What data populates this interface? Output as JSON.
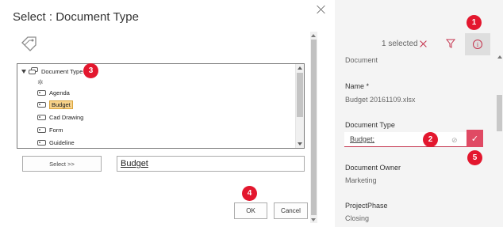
{
  "dialog": {
    "title": "Select : Document Type",
    "tree": {
      "root_label": "Document Type",
      "items": [
        {
          "label": "Agenda"
        },
        {
          "label": "Budget",
          "selected": true
        },
        {
          "label": "Cad Drawing"
        },
        {
          "label": "Form"
        },
        {
          "label": "Guideline"
        }
      ]
    },
    "select_button": "Select >>",
    "selected_value": "Budget",
    "ok_label": "OK",
    "cancel_label": "Cancel"
  },
  "panel": {
    "selection_count": "1 selected",
    "fields": {
      "content_type": "Document",
      "name_label": "Name *",
      "name_value": "Budget 20161109.xlsx",
      "doctype_label": "Document Type",
      "doctype_value": "Budget;",
      "owner_label": "Document Owner",
      "owner_value": "Marketing",
      "phase_label": "ProjectPhase",
      "phase_value": "Closing"
    }
  },
  "markers": [
    "1",
    "2",
    "3",
    "4",
    "5"
  ],
  "colors": {
    "accent": "#c4314b",
    "marker": "#e3172e",
    "check_button": "#e04a64",
    "selected_term_bg": "#f8d38b",
    "panel_bg": "#f4f4f4"
  },
  "icons": [
    "close-icon",
    "tag-icon",
    "expander-icon",
    "term-set-icon",
    "term-icon",
    "clear-selection-icon",
    "filter-icon",
    "info-icon",
    "tags-browse-icon",
    "checkmark-icon"
  ]
}
